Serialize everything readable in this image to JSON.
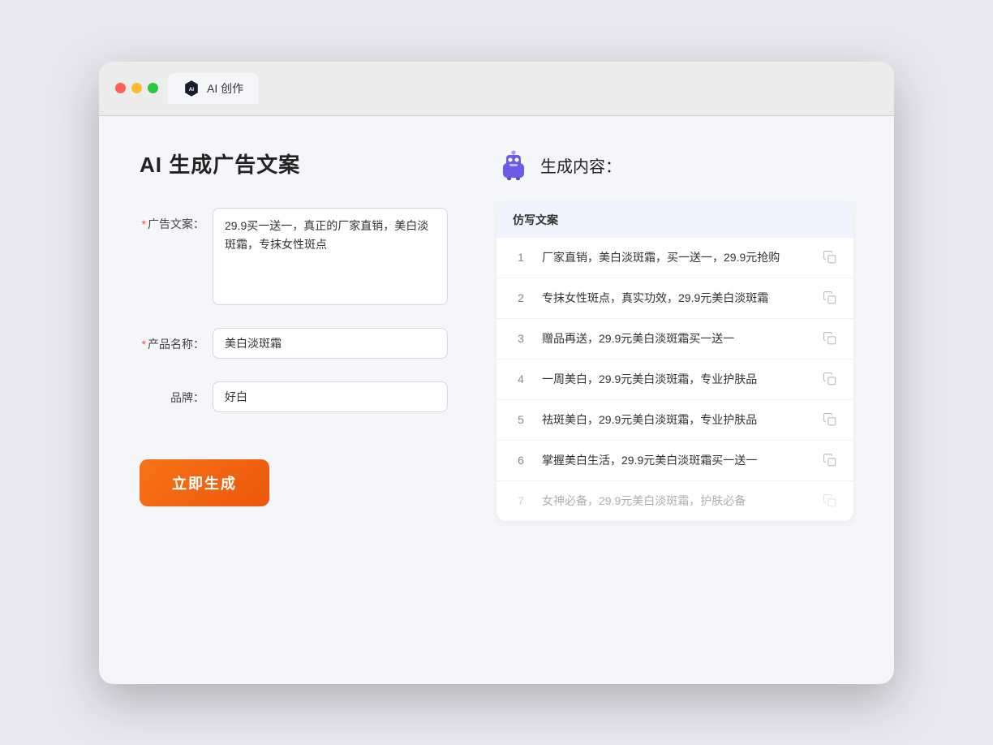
{
  "tab": {
    "label": "AI 创作"
  },
  "page": {
    "title": "AI 生成广告文案",
    "result_title": "生成内容："
  },
  "form": {
    "ad_label": "广告文案：",
    "ad_value": "29.9买一送一，真正的厂家直销，美白淡斑霜，专抹女性斑点",
    "product_label": "产品名称：",
    "product_value": "美白淡斑霜",
    "brand_label": "品牌：",
    "brand_value": "好白",
    "generate_btn": "立即生成"
  },
  "results": {
    "column_header": "仿写文案",
    "items": [
      {
        "num": "1",
        "text": "厂家直销，美白淡斑霜，买一送一，29.9元抢购",
        "muted": false
      },
      {
        "num": "2",
        "text": "专抹女性斑点，真实功效，29.9元美白淡斑霜",
        "muted": false
      },
      {
        "num": "3",
        "text": "赠品再送，29.9元美白淡斑霜买一送一",
        "muted": false
      },
      {
        "num": "4",
        "text": "一周美白，29.9元美白淡斑霜，专业护肤品",
        "muted": false
      },
      {
        "num": "5",
        "text": "祛斑美白，29.9元美白淡斑霜，专业护肤品",
        "muted": false
      },
      {
        "num": "6",
        "text": "掌握美白生活，29.9元美白淡斑霜买一送一",
        "muted": false
      },
      {
        "num": "7",
        "text": "女神必备，29.9元美白淡斑霜，护肤必备",
        "muted": true
      }
    ]
  }
}
